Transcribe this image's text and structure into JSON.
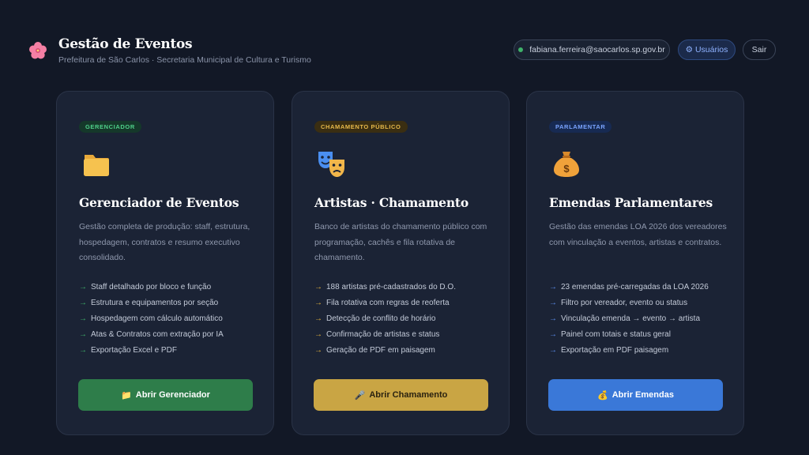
{
  "header": {
    "title": "Gestão de Eventos",
    "subtitle": "Prefeitura de São Carlos · Secretaria Municipal de Cultura e Turismo",
    "logo_icon": "flower-icon",
    "user_email": "fabiana.ferreira@saocarlos.sp.gov.br",
    "users_label": "⚙ Usuários",
    "exit_label": "Sair"
  },
  "cards": [
    {
      "badge": "GERENCIADOR",
      "icon": "folder-icon",
      "title": "Gerenciador de Eventos",
      "description": "Gestão completa de produção: staff, estrutura, hospedagem, contratos e resumo executivo consolidado.",
      "features": [
        "Staff detalhado por bloco e função",
        "Estrutura e equipamentos por seção",
        "Hospedagem com cálculo automático",
        "Atas & Contratos com extração por IA",
        "Exportação Excel e PDF"
      ],
      "button_icon": "📁",
      "button_label": "Abrir Gerenciador",
      "accent": "#2e7d4a"
    },
    {
      "badge": "CHAMAMENTO PÚBLICO",
      "icon": "theater-masks-icon",
      "title": "Artistas · Chamamento",
      "description": "Banco de artistas do chamamento público com programação, cachês e fila rotativa de chamamento.",
      "features": [
        "188 artistas pré-cadastrados do D.O.",
        "Fila rotativa com regras de reoferta",
        "Detecção de conflito de horário",
        "Confirmação de artistas e status",
        "Geração de PDF em paisagem"
      ],
      "button_icon": "🎤",
      "button_label": "Abrir Chamamento",
      "accent": "#c9a544"
    },
    {
      "badge": "PARLAMENTAR",
      "icon": "money-bag-icon",
      "title": "Emendas Parlamentares",
      "description": "Gestão das emendas LOA 2026 dos vereadores com vinculação a eventos, artistas e contratos.",
      "features": [
        "23 emendas pré-carregadas da LOA 2026",
        "Filtro por vereador, evento ou status",
        "Vinculação emenda → evento → artista",
        "Painel com totais e status geral",
        "Exportação em PDF paisagem"
      ],
      "button_icon": "💰",
      "button_label": "Abrir Emendas",
      "accent": "#3a78d8"
    }
  ],
  "feature_arrow": "→"
}
